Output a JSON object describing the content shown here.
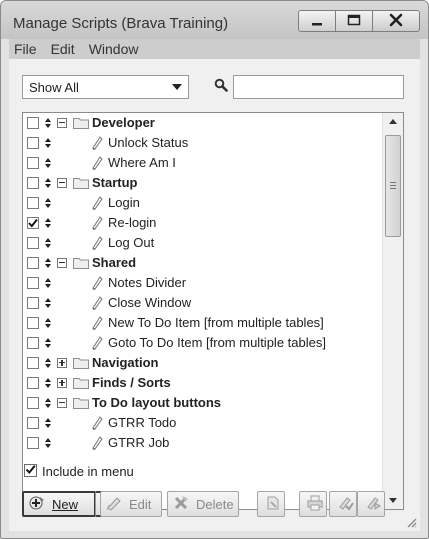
{
  "window": {
    "title": "Manage Scripts (Brava Training)"
  },
  "menubar": {
    "items": [
      "File",
      "Edit",
      "Window"
    ]
  },
  "filter": {
    "selected": "Show All",
    "search_value": ""
  },
  "scripts": [
    {
      "type": "folder",
      "label": "Developer",
      "checked": false,
      "expanded": true
    },
    {
      "type": "script",
      "label": "Unlock Status",
      "checked": false
    },
    {
      "type": "script",
      "label": "Where Am I",
      "checked": false
    },
    {
      "type": "folder",
      "label": "Startup",
      "checked": false,
      "expanded": true
    },
    {
      "type": "script",
      "label": "Login",
      "checked": false
    },
    {
      "type": "script",
      "label": "Re-login",
      "checked": true
    },
    {
      "type": "script",
      "label": "Log Out",
      "checked": false
    },
    {
      "type": "folder",
      "label": "Shared",
      "checked": false,
      "expanded": true
    },
    {
      "type": "script",
      "label": "Notes Divider",
      "checked": false
    },
    {
      "type": "script",
      "label": "Close Window",
      "checked": false
    },
    {
      "type": "script",
      "label": "New To Do Item [from multiple tables]",
      "checked": false
    },
    {
      "type": "script",
      "label": "Goto To Do Item [from multiple tables]",
      "checked": false
    },
    {
      "type": "folder",
      "label": "Navigation",
      "checked": false,
      "expanded": false
    },
    {
      "type": "folder",
      "label": "Finds / Sorts",
      "checked": false,
      "expanded": false
    },
    {
      "type": "folder",
      "label": "To Do layout buttons",
      "checked": false,
      "expanded": true
    },
    {
      "type": "script",
      "label": "GTRR Todo",
      "checked": false
    },
    {
      "type": "script",
      "label": "GTRR Job",
      "checked": false
    }
  ],
  "include_menu": {
    "label": "Include in menu",
    "checked": true
  },
  "toolbar": {
    "new_label": "New",
    "edit_label": "Edit",
    "delete_label": "Delete"
  },
  "colors": {
    "window_bg": "#e2e2e2",
    "list_bg": "#ffffff",
    "titlebar": "#c8c8c8"
  }
}
